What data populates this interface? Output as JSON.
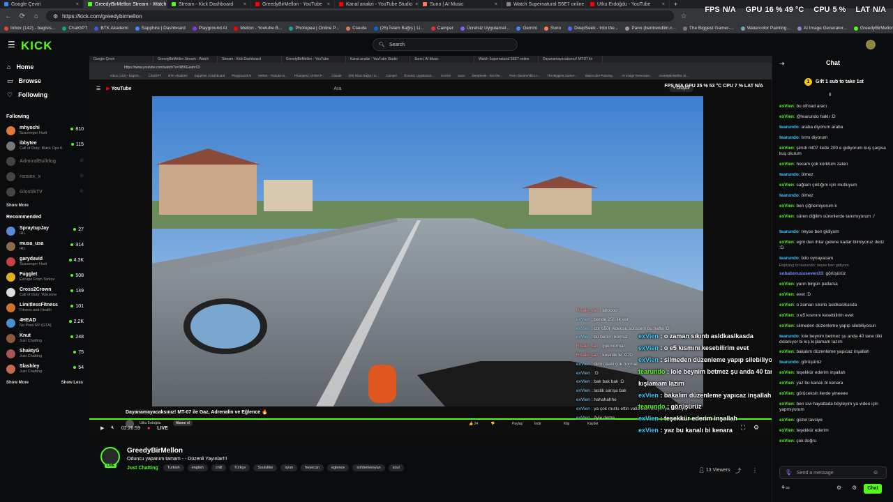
{
  "browser": {
    "tabs": [
      {
        "label": "Google Çeviri",
        "color": "#4285f4"
      },
      {
        "label": "GreedyBirMellon Stream - Watch",
        "color": "#53fc18",
        "active": true
      },
      {
        "label": "Stream - Kick Dashboard",
        "color": "#53fc18"
      },
      {
        "label": "GreedyBirMellon - YouTube",
        "color": "#ff0000"
      },
      {
        "label": "Kanal analizi - YouTube Studio",
        "color": "#ff0000"
      },
      {
        "label": "Suno | AI Music",
        "color": "#ff7a59"
      },
      {
        "label": "Watch Supernatural S6E7 online",
        "color": "#888888"
      },
      {
        "label": "Utku Erdoğdu - YouTube",
        "color": "#ff0000"
      }
    ],
    "url": "https://kick.com/greedybirmellon",
    "bookmarks": [
      "Inbox (142) - bagisis...",
      "ChatGPT",
      "BTK Akademi",
      "Sapphire | Dashboard",
      "Playground AI",
      "Mellon - Youtube B...",
      "Photopea | Online P...",
      "Claude",
      "(25) İslam Bağış | Li...",
      "Camper",
      "Ücretsiz Uygulamal...",
      "Gemini",
      "Suno",
      "DeepSeek - Into the...",
      "Pano (bentrendlim.c...",
      "The Biggest Gamer-...",
      "Watercolor Painting...",
      "AI Image Generator...",
      "GreedyBirMellon St..."
    ]
  },
  "stats": {
    "fps_label": "FPS",
    "fps": "N/A",
    "gpu_label": "GPU",
    "gpu": "16 % 49 °C",
    "cpu_label": "CPU",
    "cpu": "5 %",
    "lat_label": "LAT",
    "lat": "N/A"
  },
  "kick": {
    "logo": "KICK",
    "search_placeholder": "Search"
  },
  "sidebar": {
    "nav": [
      {
        "label": "Home"
      },
      {
        "label": "Browse"
      },
      {
        "label": "Following"
      }
    ],
    "following_title": "Following",
    "following": [
      {
        "name": "mhyochi",
        "game": "Scavenger Hunt",
        "viewers": "810",
        "color": "#e07a3a"
      },
      {
        "name": "ibbytee",
        "game": "Call of Duty: Black Ops 6",
        "viewers": "115",
        "color": "#777777"
      },
      {
        "name": "AdmiralBulldog",
        "game": "",
        "viewers": "",
        "color": "#444444",
        "off": true
      },
      {
        "name": "remiex_x",
        "game": "",
        "viewers": "",
        "color": "#444444",
        "off": true
      },
      {
        "name": "GlostikTV",
        "game": "",
        "viewers": "",
        "color": "#444444",
        "off": true
      }
    ],
    "show_more": "Show More",
    "recommended_title": "Recommended",
    "recommended": [
      {
        "name": "SpraytupJay",
        "game": "IRL",
        "viewers": "27",
        "color": "#5b8bd8"
      },
      {
        "name": "musa_usa",
        "game": "IRL",
        "viewers": "314",
        "color": "#8b6b4a"
      },
      {
        "name": "garydavid",
        "game": "Scavenger Hunt",
        "viewers": "4.3K",
        "color": "#c94040"
      },
      {
        "name": "Fugglet",
        "game": "Escape From Tarkov",
        "viewers": "508",
        "color": "#e0b020"
      },
      {
        "name": "Cross2Crown",
        "game": "Call of Duty: Warzone",
        "viewers": "149",
        "color": "#dddddd"
      },
      {
        "name": "LimitlessFitness",
        "game": "Fitness and Health",
        "viewers": "101",
        "color": "#d07030"
      },
      {
        "name": "4HEAD",
        "game": "No Pixel RP (GTA)",
        "viewers": "2.2K",
        "color": "#4a90d0"
      },
      {
        "name": "Knut",
        "game": "Just Chatting",
        "viewers": "248",
        "color": "#8a5a3a"
      },
      {
        "name": "ShaktyG",
        "game": "Just Chatting",
        "viewers": "75",
        "color": "#aa5555"
      },
      {
        "name": "Slashley",
        "game": "Just Chatting",
        "viewers": "54",
        "color": "#c06a50"
      }
    ],
    "show_more2": "Show More",
    "show_less": "Show Less"
  },
  "stream": {
    "inner_tabs": [
      "Google Çeviri",
      "GreedyBirMellon Stream - Watch",
      "Stream - Kick Dashboard",
      "GreedyBirMellon - YouTube",
      "Kanal analizi - YouTube Studio",
      "Suno | AI Music",
      "Watch Supernatural S6E7 online",
      "Dayanamayacaksınız! MT-07 ile"
    ],
    "inner_url": "https://www.youtube.com/watch?v=3iBKGauhrC0",
    "inner_stats": "FPS N/A   GPU 25 % 53 °C   CPU 7 %   LAT N/A",
    "yt_logo": "YouTube",
    "yt_search": "Ara",
    "yt_subscribe": "+ Oluştur",
    "video_title": "Dayanamayacaksınız! MT-07 ile Gaz, Adrenalin ve Eğlence 🔥",
    "yt_channel": "Utku Erdoğdu",
    "yt_subscribe_btn": "Abone ol",
    "yt_actions": [
      "👍 24",
      "👎",
      "Paylaş",
      "İndir",
      "Klip",
      "Kaydet"
    ],
    "time": "02:26:59",
    "live": "LIVE"
  },
  "overlay_small": [
    {
      "u": "Risaki_san",
      "m": "aboooo",
      "r": true
    },
    {
      "u": "exVien",
      "m": "bende 250 lik var"
    },
    {
      "u": "exVien",
      "m": "cbr 650r videosu sürücem bu hafta :D"
    },
    {
      "u": "exVien",
      "m": "bu benim normal"
    },
    {
      "u": "Risaki_san",
      "m": "çok normal",
      "r": true
    },
    {
      "u": "Risaki_san",
      "m": "kesinlik le XDD",
      "r": true
    },
    {
      "u": "exVien",
      "m": "dimi risaki çok normal"
    },
    {
      "u": "exVien",
      "m": ":D"
    },
    {
      "u": "exVien",
      "m": "bak bak bak :D"
    },
    {
      "u": "exVien",
      "m": "lastik sarışa bak"
    },
    {
      "u": "exVien",
      "m": "hahahahhe"
    },
    {
      "u": "exVien",
      "m": "ya çok mutlu ettin valla beni izleyin ya videoyu"
    },
    {
      "u": "exVien",
      "m": "öyle deme"
    }
  ],
  "overlay_big": [
    {
      "u": "exVien",
      "m": "o zaman sıkıntı asldkaslkasda"
    },
    {
      "u": "exVien",
      "m": "o e5 kısmını kesebilirim evet"
    },
    {
      "u": "exVien",
      "m": "silmeden düzenleme yapıp silebiliyosun"
    },
    {
      "u": "tearundo",
      "m": "lole beynim betmez şu anda 40 tane tilki dolanıyor bi kış",
      "y": true
    },
    {
      "u": "",
      "m": "kışlamam lazım"
    },
    {
      "u": "exVien",
      "m": "bakalım düzenleme yapıcaz inşallah"
    },
    {
      "u": "tearundo",
      "m": "görüşürüz",
      "y": true
    },
    {
      "u": "exVien",
      "m": "teşekkür ederim inşallah"
    },
    {
      "u": "exVien",
      "m": "yaz bu kanalı bi kenara"
    },
    {
      "u": "exVien",
      "m": "görüceksin ilerde yineeee"
    },
    {
      "u": "exVien",
      "m": "ben sivi hayattada böyleyim ya video için yapmıyorum"
    },
    {
      "u": "exVien",
      "m": "güzel tavsiye"
    },
    {
      "u": "exVien",
      "m": "teşekkür ederim"
    },
    {
      "u": "exVien",
      "m": "çok doğru"
    }
  ],
  "channel": {
    "name": "GreedyBirMellon",
    "title": "Oduncu yapanım tamam  - - Düzenli Yayınlar!!!",
    "live": "LIVE",
    "category": "Just Chatting",
    "tags": [
      "Turkish",
      "english",
      "chill",
      "Türkçe",
      "Soulslike",
      "oyun",
      "heyecan",
      "eglence",
      "sohbetveoyun",
      "soul"
    ],
    "viewers": "13 Viewers"
  },
  "chat": {
    "title": "Chat",
    "gift": "Gift 1 sub to take 1st",
    "messages": [
      {
        "u": "exVien",
        "m": "bu ofroad aracı"
      },
      {
        "u": "exVien",
        "m": "@tearundo haklı :D"
      },
      {
        "u": "tearundo",
        "m": "araba diyorum araba",
        "c": "u2"
      },
      {
        "u": "tearundo",
        "m": "tırmı diyorum",
        "c": "u2"
      },
      {
        "u": "exVien",
        "m": "şimdi mt07 ilede 200 e gidiyorum kuş çarpsa kuş olurum"
      },
      {
        "u": "exVien",
        "m": "hocam çok korktum zaten"
      },
      {
        "u": "tearundo",
        "m": "ölmez",
        "c": "u2"
      },
      {
        "u": "exVien",
        "m": "sağlam çıktığım için mutluyum"
      },
      {
        "u": "tearundo",
        "m": "ölmez",
        "c": "u2"
      },
      {
        "u": "exVien",
        "m": "ben çiğnemiyorum k"
      },
      {
        "u": "exVien",
        "m": "süren diğilim sürenlerde tanımıyorum :/"
      },
      {
        "u": "tearundo",
        "m": "neyse ben gidiyom",
        "c": "u2"
      },
      {
        "u": "exVien",
        "m": "egm den ihtar gelene kadar bilmiyoruz deriz :D"
      },
      {
        "u": "tearundo",
        "m": "bdo oynayacam",
        "c": "u2"
      },
      {
        "u": "sobaborususeven33",
        "m": "görüşürüz",
        "c": "u3"
      },
      {
        "u": "exVien",
        "m": "yarın birgün patlarsa"
      },
      {
        "u": "exVien",
        "m": "evet :D"
      },
      {
        "u": "exVien",
        "m": "o zaman sıkıntı asldkaslkasda"
      },
      {
        "u": "exVien",
        "m": "o e5 kısmını kesebilirim evet"
      },
      {
        "u": "exVien",
        "m": "silmeden düzenleme yapıp silebiliyosun"
      },
      {
        "u": "tearundo",
        "m": "lole beynim betmez şu anda 40 tane tilki dolanıyor bi kış kışlamam lazım",
        "c": "u2"
      },
      {
        "u": "exVien",
        "m": "bakalım düzenleme yapıcaz inşallah"
      },
      {
        "u": "tearundo",
        "m": "görüşürüz",
        "c": "u2"
      },
      {
        "u": "exVien",
        "m": "teşekkür ederim inşallah"
      },
      {
        "u": "exVien",
        "m": "yaz bu kanalı bi kenara"
      },
      {
        "u": "exVien",
        "m": "görüceksin ilerde yineeee"
      },
      {
        "u": "exVien",
        "m": "ben sivi hayattada böyleyim ya video için yapmıyorum"
      },
      {
        "u": "exVien",
        "m": "güzel tavsiye"
      },
      {
        "u": "exVien",
        "m": "teşekkür ederim"
      },
      {
        "u": "exVien",
        "m": "çok doğru"
      }
    ],
    "reply_note": "Replying to tearundo: neyse ben gidiyom",
    "placeholder": "Send a message",
    "send": "Chat"
  }
}
